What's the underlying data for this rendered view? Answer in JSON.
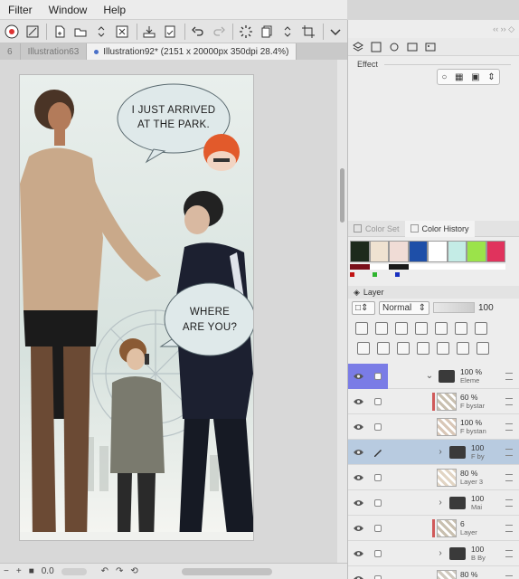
{
  "menu": [
    "Filter",
    "Window",
    "Help"
  ],
  "toolbar_icons": [
    "app-logo-icon",
    "transform-icon",
    "new-file-icon",
    "open-folder-icon",
    "scroll-arrows-icon",
    "close-x-icon",
    "save-tray-icon",
    "save-doc-icon",
    "undo-icon",
    "redo-icon",
    "loading-spinner-icon",
    "copy-layers-icon",
    "chevron-arrows-icon",
    "crop-icon",
    "chevron-down-icon"
  ],
  "tabs": [
    {
      "label": "6"
    },
    {
      "label": "Illustration63"
    },
    {
      "label": "Illustration92* (2151 x 20000px 350dpi 28.4%)"
    }
  ],
  "canvas": {
    "bubble1_line1": "I JUST ARRIVED",
    "bubble1_line2": "AT THE PARK.",
    "bubble2_line1": "WHERE",
    "bubble2_line2": "ARE YOU?"
  },
  "status": {
    "zoom_value": "0.0"
  },
  "effect": {
    "label": "Effect"
  },
  "color_panel": {
    "tab_color_set": "Color Set",
    "tab_color_history": "Color History",
    "swatches_row1": [
      "#1d2a1c",
      "#efe2d1",
      "#f0dcd6",
      "#1e4fa8",
      "#ffffff",
      "#c4ece6",
      "#9be34a",
      "#e0335d"
    ],
    "swatches_row2": [
      "#7a0f1a",
      "#ffffff",
      "#1a1a1a",
      "#ffffff",
      "#ffffff",
      "#ffffff",
      "#ffffff",
      "#ffffff"
    ],
    "mini_dots": [
      "#c11414",
      "#2fb52f",
      "#1830c0"
    ]
  },
  "layer_panel": {
    "title": "Layer",
    "blend_mode": "Normal",
    "opacity": "100",
    "layers": [
      {
        "pct": "100 %",
        "name": "Eleme",
        "type": "folder",
        "open": true
      },
      {
        "pct": "60 %",
        "name": "F bystar",
        "type": "raster",
        "mark": true
      },
      {
        "pct": "100 %",
        "name": "F bystan",
        "type": "raster"
      },
      {
        "pct": "100",
        "name": "F by",
        "type": "folder",
        "selected": true
      },
      {
        "pct": "80 %",
        "name": "Layer 3",
        "type": "raster"
      },
      {
        "pct": "100",
        "name": "Mai",
        "type": "folder"
      },
      {
        "pct": "6",
        "name": "Layer",
        "type": "raster",
        "mark": true
      },
      {
        "pct": "100",
        "name": "B By",
        "type": "folder"
      },
      {
        "pct": "80 %",
        "name": "Ad",
        "type": "raster"
      }
    ]
  }
}
